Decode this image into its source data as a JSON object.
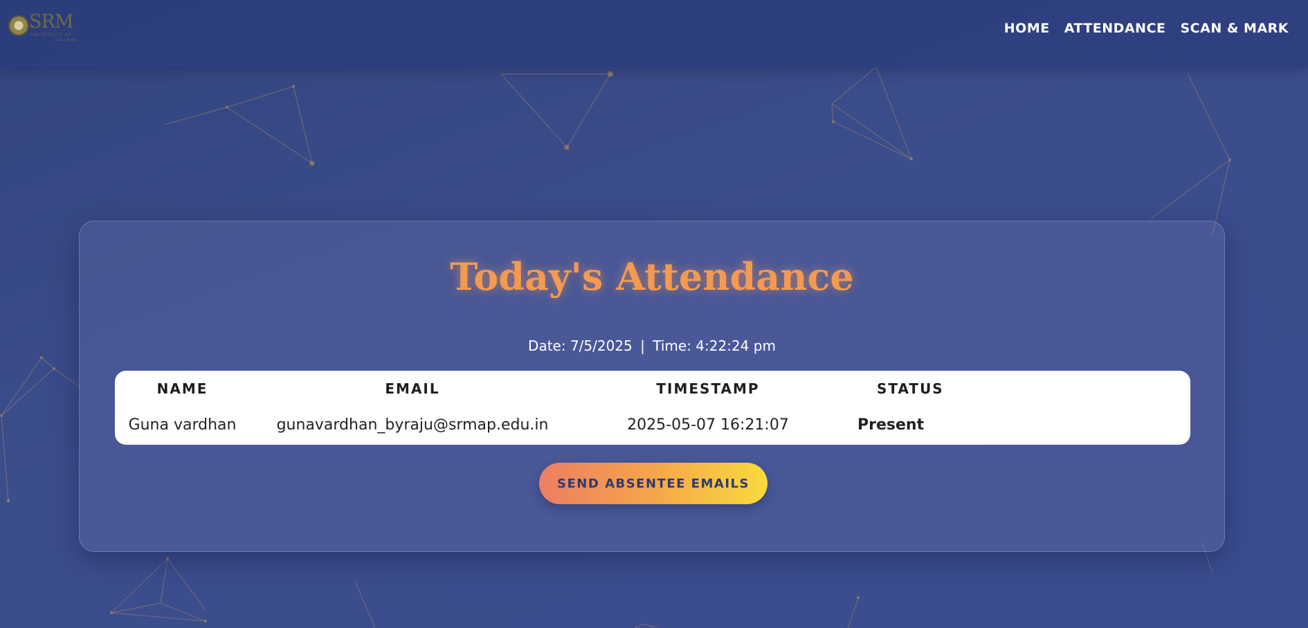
{
  "header": {
    "logo": {
      "name": "SRM",
      "subtitle": "UNIVERSITY AP",
      "tagline": "Andhra Pradesh"
    },
    "nav": [
      {
        "label": "HOME"
      },
      {
        "label": "ATTENDANCE"
      },
      {
        "label": "SCAN & MARK"
      }
    ]
  },
  "main": {
    "title": "Today's Attendance",
    "date_label": "Date:",
    "date_value": "7/5/2025",
    "time_label": "Time:",
    "time_value": "4:22:24 pm",
    "table": {
      "columns": [
        "NAME",
        "EMAIL",
        "TIMESTAMP",
        "STATUS"
      ],
      "rows": [
        {
          "name": "Guna vardhan",
          "email": "gunavardhan_byraju@srmap.edu.in",
          "timestamp": "2025-05-07 16:21:07",
          "status": "Present"
        }
      ]
    },
    "send_button_label": "SEND ABSENTEE EMAILS"
  },
  "colors": {
    "background": "#3a4b88",
    "title": "#f39a50",
    "button_start": "#ee7d62",
    "button_end": "#f8db3e",
    "button_text": "#2e3a6e"
  }
}
